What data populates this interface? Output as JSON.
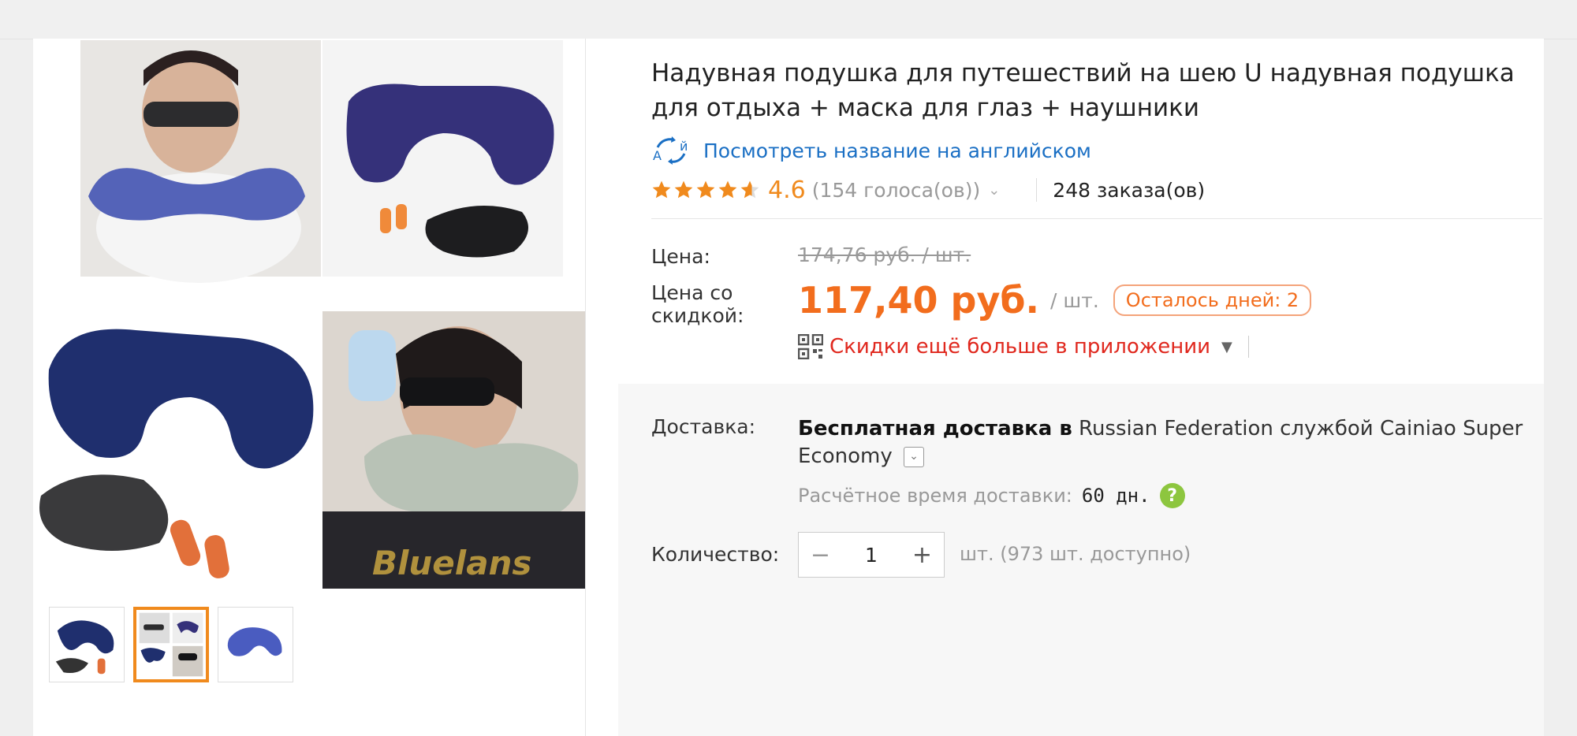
{
  "product": {
    "title": "Надувная подушка для путешествий на шею U надувная подушка для отдыха + маска для глаз + наушники",
    "translate_link": "Посмотреть название на английском",
    "rating": "4.6",
    "votes": "(154 голоса(ов))",
    "orders": "248 заказа(ов)"
  },
  "price": {
    "label": "Цена:",
    "old_value": "174,76 руб. / шт.",
    "discount_label": "Цена со скидкой:",
    "new_value": "117,40 руб.",
    "per_unit": "/ шт.",
    "days_left": "Осталось дней: 2",
    "app_discount": "Скидки ещё больше в приложении"
  },
  "delivery": {
    "label": "Доставка:",
    "bold": "Бесплатная доставка в",
    "rest": "Russian Federation службой Cainiao Super Economy",
    "eta_label": "Расчётное время доставки:",
    "eta_value": "60 дн.",
    "help": "?"
  },
  "quantity": {
    "label": "Количество:",
    "value": "1",
    "minus": "−",
    "plus": "+",
    "stock": "шт. (973 шт. доступно)"
  },
  "gallery": {
    "watermark": "Bluelans",
    "active_thumb": 2
  },
  "colors": {
    "accent": "#f08a1d",
    "price": "#f26d1d",
    "link": "#1a6fc4",
    "app_red": "#e0281e",
    "help_green": "#8dc63f"
  },
  "icons": [
    "translate-icon",
    "star-icon",
    "chevron-down-icon",
    "qr-code-icon",
    "triangle-down-icon",
    "help-icon"
  ]
}
